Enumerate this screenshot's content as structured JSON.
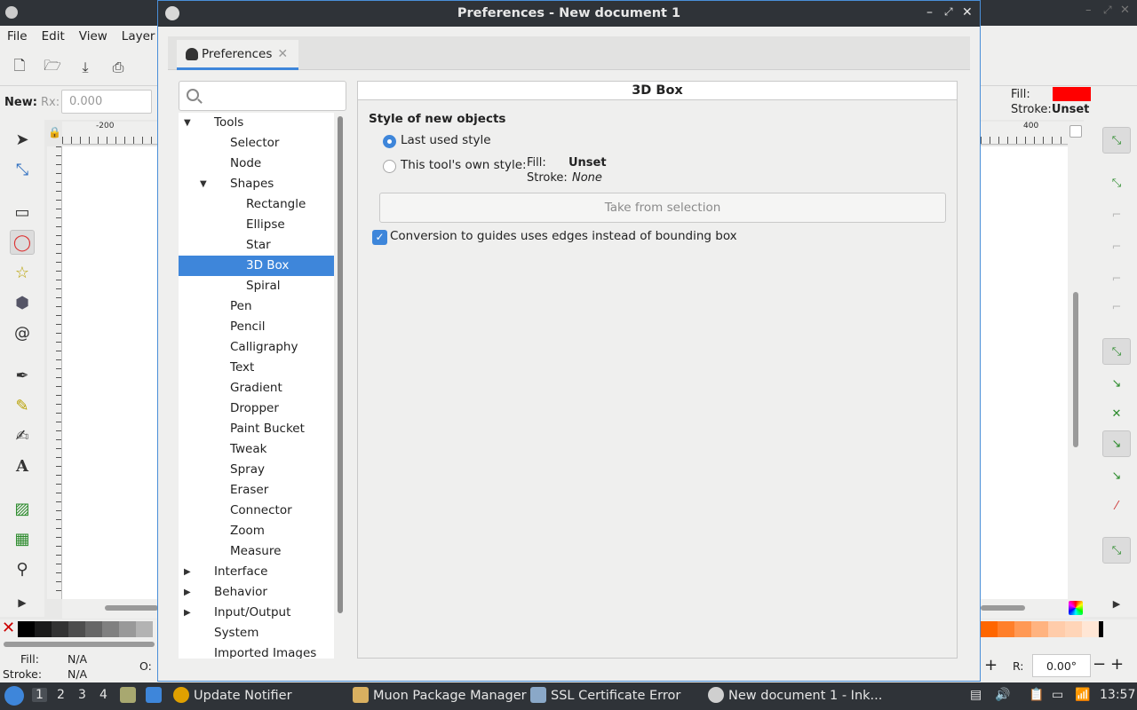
{
  "background_app": {
    "menu": [
      "File",
      "Edit",
      "View",
      "Layer"
    ],
    "toolctrl": {
      "new_label": "New:",
      "rx_label": "Rx:",
      "rx_value": "0.000"
    },
    "fill_label": "Fill:",
    "stroke_label": "Stroke:",
    "stroke_value": "Unset",
    "fill_color": "#ff0000",
    "ruler_top_left": "-200",
    "ruler_top_right": "400",
    "status": {
      "fill_label": "Fill:",
      "stroke_label": "Stroke:",
      "fill_value": "N/A",
      "stroke_value": "N/A",
      "o_label": "O:",
      "r_label": "R:",
      "rotation": "0.00°"
    }
  },
  "dialog": {
    "title": "Preferences - New document 1",
    "tab_label": "Preferences",
    "search_placeholder": "",
    "tree": [
      {
        "label": "Tools",
        "level": 0,
        "arrow": "open"
      },
      {
        "label": "Selector",
        "level": 1
      },
      {
        "label": "Node",
        "level": 1
      },
      {
        "label": "Shapes",
        "level": 1,
        "arrow": "open"
      },
      {
        "label": "Rectangle",
        "level": 2
      },
      {
        "label": "Ellipse",
        "level": 2
      },
      {
        "label": "Star",
        "level": 2
      },
      {
        "label": "3D Box",
        "level": 2,
        "selected": true
      },
      {
        "label": "Spiral",
        "level": 2
      },
      {
        "label": "Pen",
        "level": 1
      },
      {
        "label": "Pencil",
        "level": 1
      },
      {
        "label": "Calligraphy",
        "level": 1
      },
      {
        "label": "Text",
        "level": 1
      },
      {
        "label": "Gradient",
        "level": 1
      },
      {
        "label": "Dropper",
        "level": 1
      },
      {
        "label": "Paint Bucket",
        "level": 1
      },
      {
        "label": "Tweak",
        "level": 1
      },
      {
        "label": "Spray",
        "level": 1
      },
      {
        "label": "Eraser",
        "level": 1
      },
      {
        "label": "Connector",
        "level": 1
      },
      {
        "label": "Zoom",
        "level": 1
      },
      {
        "label": "Measure",
        "level": 1
      },
      {
        "label": "Interface",
        "level": 0,
        "arrow": "closed"
      },
      {
        "label": "Behavior",
        "level": 0,
        "arrow": "closed"
      },
      {
        "label": "Input/Output",
        "level": 0,
        "arrow": "closed"
      },
      {
        "label": "System",
        "level": 0
      },
      {
        "label": "Imported Images",
        "level": 0
      }
    ],
    "page": {
      "heading": "3D Box",
      "section_title": "Style of new objects",
      "radio_last_used": "Last used style",
      "radio_own_style": "This tool's own style:",
      "own_fill_label": "Fill:",
      "own_fill_value": "Unset",
      "own_stroke_label": "Stroke:",
      "own_stroke_value": "None",
      "take_button": "Take from selection",
      "checkbox_label": "Conversion to guides uses edges instead of bounding box"
    }
  },
  "taskbar": {
    "workspaces": [
      "1",
      "2",
      "3",
      "4"
    ],
    "tasks": [
      "Update Notifier",
      "Muon Package Manager",
      "SSL Certificate Error",
      "New document 1 - Ink..."
    ],
    "clock": "13:57"
  }
}
